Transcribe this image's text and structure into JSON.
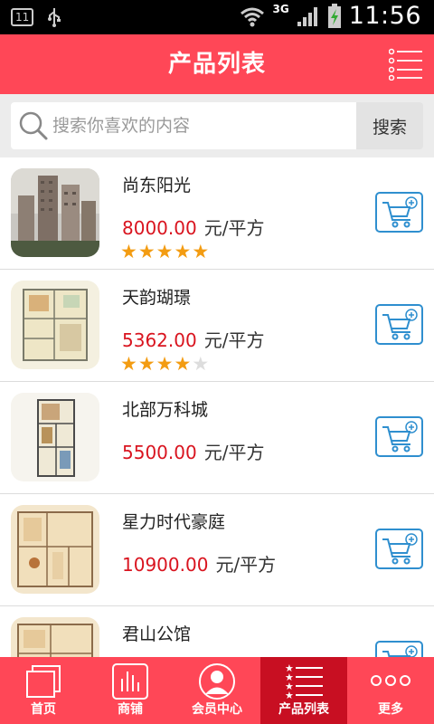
{
  "status_bar": {
    "notification_count": "11",
    "network_type": "3G",
    "time": "11:56"
  },
  "header": {
    "title": "产品列表"
  },
  "search": {
    "placeholder": "搜索你喜欢的内容",
    "button_label": "搜索"
  },
  "products": [
    {
      "name": "尚东阳光",
      "price": "8000.00",
      "unit": "元/平方",
      "rating": 5
    },
    {
      "name": "天韵瑚璟",
      "price": "5362.00",
      "unit": "元/平方",
      "rating": 4
    },
    {
      "name": "北部万科城",
      "price": "5500.00",
      "unit": "元/平方",
      "rating": 0
    },
    {
      "name": "星力时代豪庭",
      "price": "10900.00",
      "unit": "元/平方",
      "rating": 0
    },
    {
      "name": "君山公馆",
      "price": "",
      "unit": "",
      "rating": 0
    }
  ],
  "tabs": [
    {
      "label": "首页",
      "icon": "home-icon"
    },
    {
      "label": "商铺",
      "icon": "shop-icon"
    },
    {
      "label": "会员中心",
      "icon": "member-icon"
    },
    {
      "label": "产品列表",
      "icon": "product-list-icon"
    },
    {
      "label": "更多",
      "icon": "more-icon"
    }
  ],
  "active_tab": 3,
  "colors": {
    "brand_red": "#ff4757",
    "active_tab": "#c80f22",
    "price_red": "#d9141f",
    "cart_blue": "#2f8fcf",
    "star_orange": "#f39c12"
  }
}
